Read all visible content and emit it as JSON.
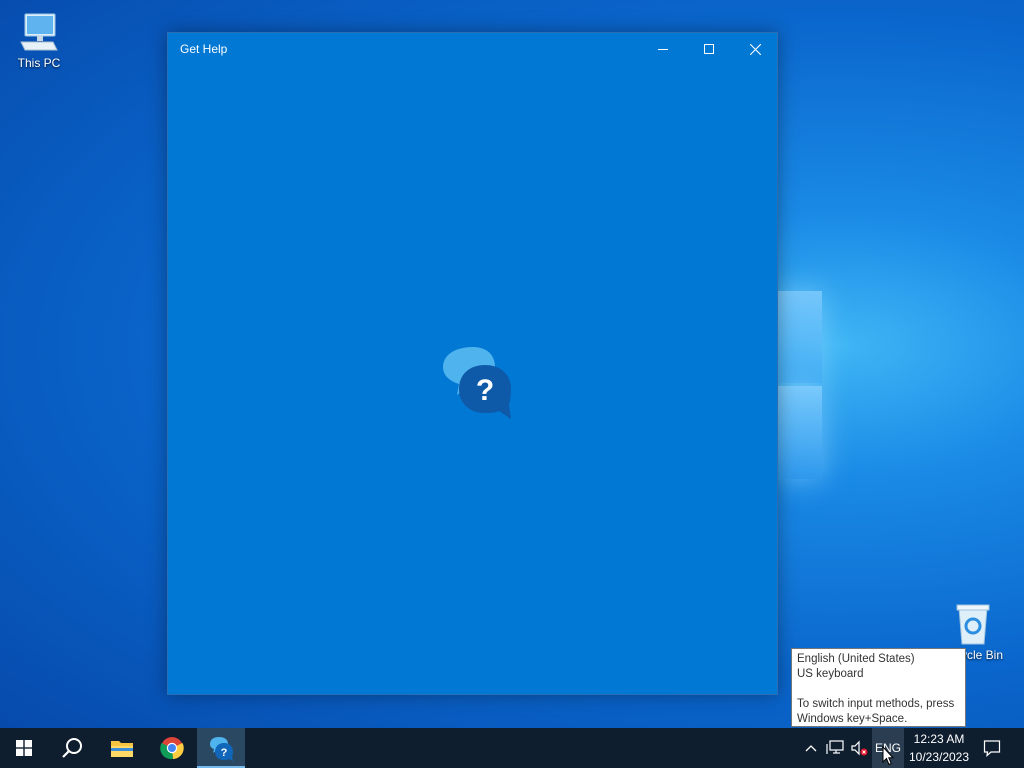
{
  "desktop": {
    "icons": [
      {
        "label": "This PC",
        "icon": "computer-icon"
      },
      {
        "label": "ycle Bin",
        "icon": "recycle-bin-icon"
      }
    ]
  },
  "window": {
    "title": "Get Help",
    "app_icon": "get-help-icon",
    "background_color": "#0078d4"
  },
  "tooltip": {
    "language": "English (United States)",
    "keyboard": "US keyboard",
    "hint_line1": "To switch input methods, press",
    "hint_line2": "Windows key+Space."
  },
  "taskbar": {
    "apps": [
      {
        "name": "start",
        "icon": "windows-logo-icon"
      },
      {
        "name": "search",
        "icon": "search-icon"
      },
      {
        "name": "file-explorer",
        "icon": "folder-icon"
      },
      {
        "name": "chrome",
        "icon": "chrome-icon"
      },
      {
        "name": "get-help",
        "icon": "get-help-icon",
        "active": true
      }
    ],
    "tray": {
      "language": "ENG",
      "time": "12:23 AM",
      "date": "10/23/2023"
    }
  }
}
